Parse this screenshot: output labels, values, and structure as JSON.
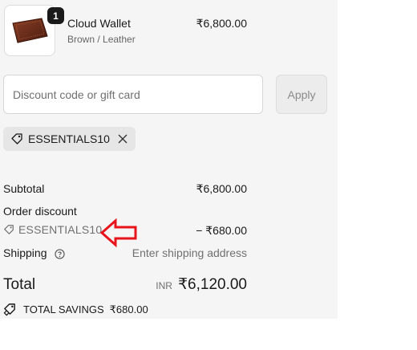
{
  "product": {
    "name": "Cloud Wallet",
    "variant": "Brown / Leather",
    "price": "₹6,800.00",
    "quantity": "1",
    "image_icon": "wallet-image"
  },
  "discount": {
    "placeholder": "Discount code or gift card",
    "value": "",
    "apply_label": "Apply",
    "applied_code": "ESSENTIALS10"
  },
  "summary": {
    "subtotal_label": "Subtotal",
    "subtotal_value": "₹6,800.00",
    "order_discount_label": "Order discount",
    "discount_code": "ESSENTIALS10",
    "discount_value": "− ₹680.00",
    "shipping_label": "Shipping",
    "shipping_value": "Enter shipping address",
    "total_label": "Total",
    "currency": "INR",
    "total_value": "₹6,120.00",
    "savings_label": "TOTAL SAVINGS",
    "savings_value": "₹680.00"
  },
  "colors": {
    "panel_bg": "#f5f5f5",
    "annotation_arrow": "#e8141c",
    "muted_text": "#707070"
  }
}
